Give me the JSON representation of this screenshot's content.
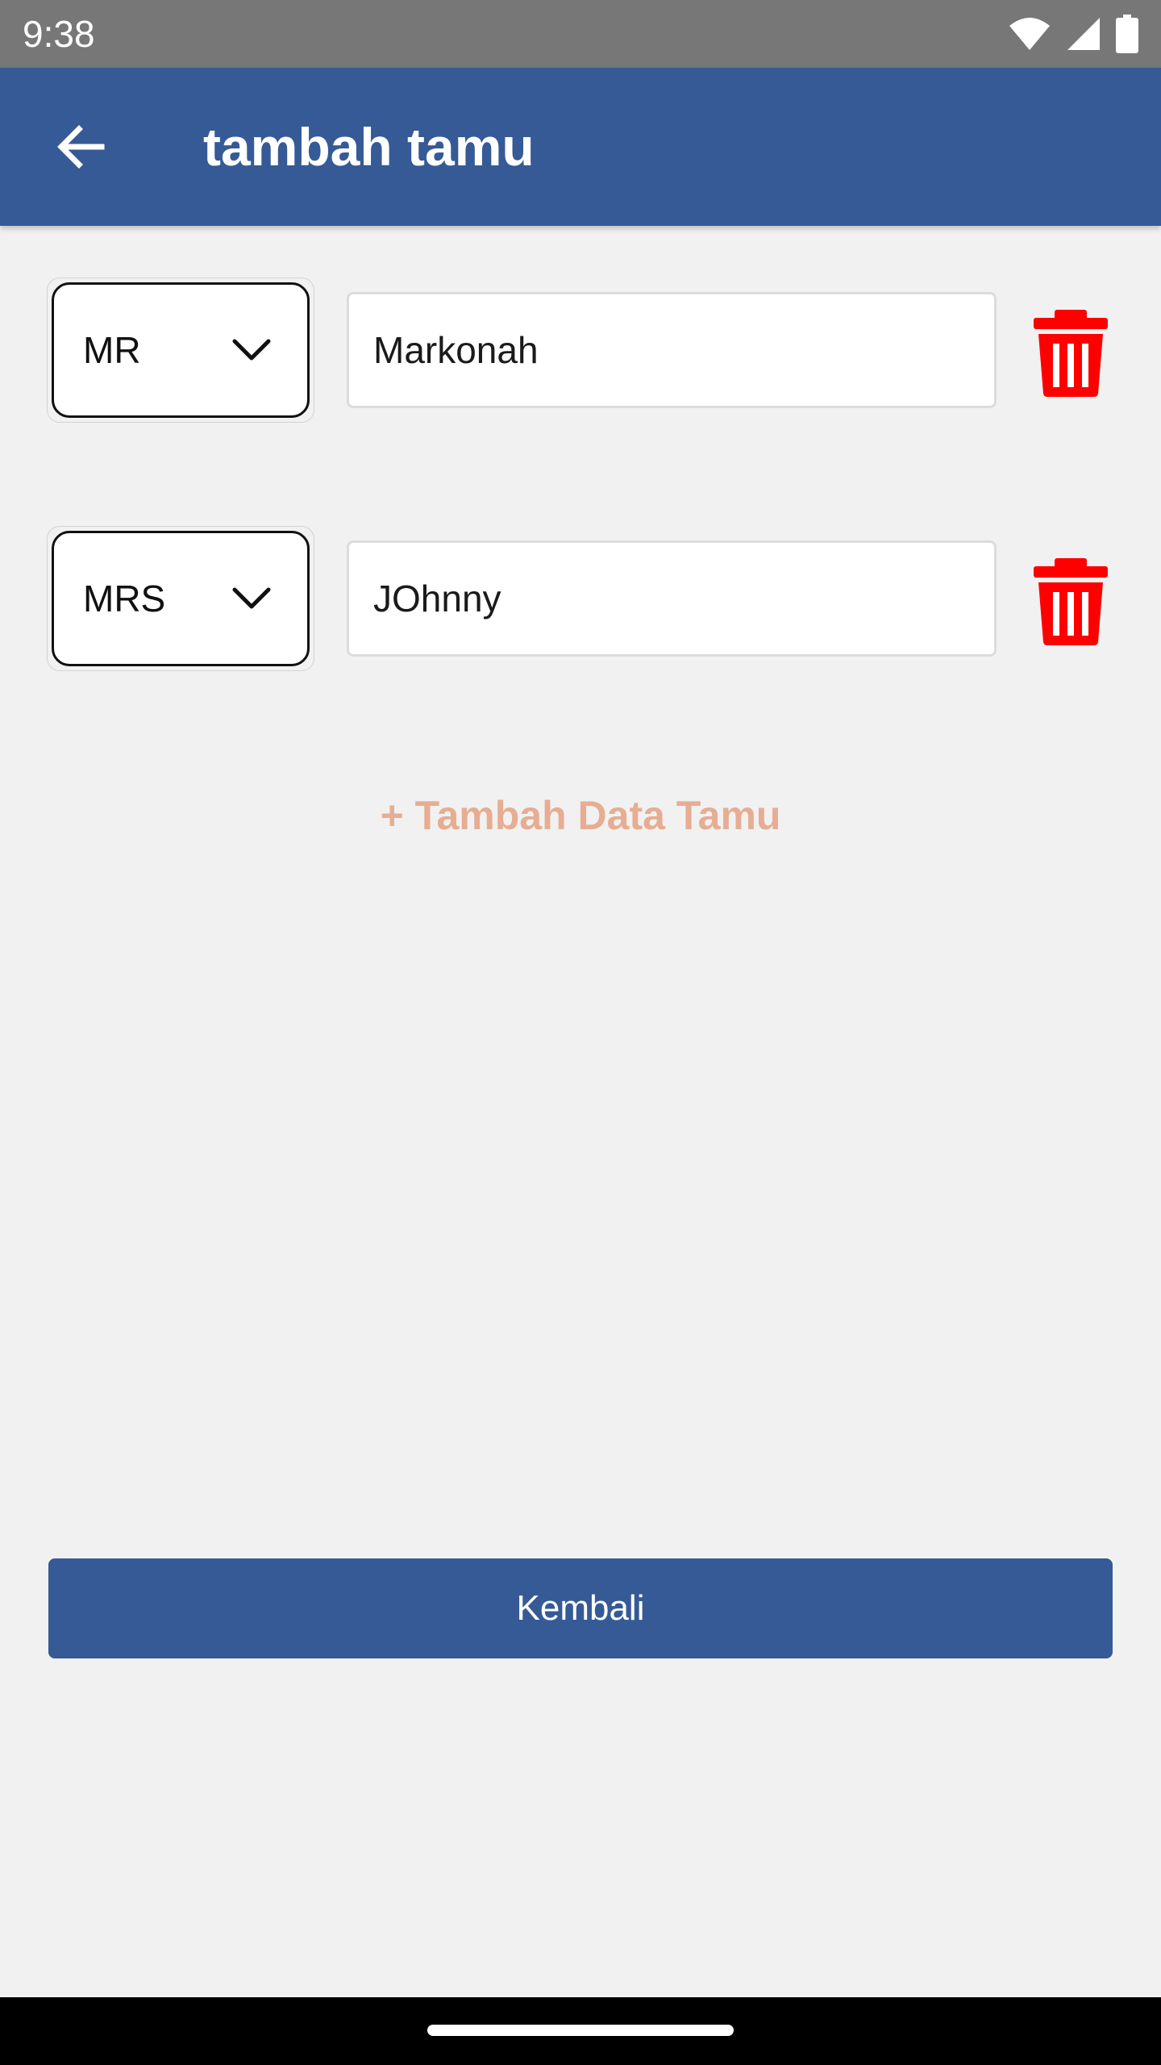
{
  "status_bar": {
    "time": "9:38",
    "icons": [
      "wifi-icon",
      "signal-icon",
      "battery-icon"
    ]
  },
  "app_bar": {
    "title": "tambah tamu",
    "back_icon": "arrow-left-icon"
  },
  "guests": [
    {
      "title": "MR",
      "name": "Markonah"
    },
    {
      "title": "MRS",
      "name": "JOhnny"
    }
  ],
  "add_guest_label": "+ Tambah Data Tamu",
  "back_button_label": "Kembali",
  "colors": {
    "primary": "#355a96",
    "background": "#f1f1f1",
    "delete": "#ff0000",
    "add_link": "#e7ad93",
    "status_bar": "#777777"
  }
}
